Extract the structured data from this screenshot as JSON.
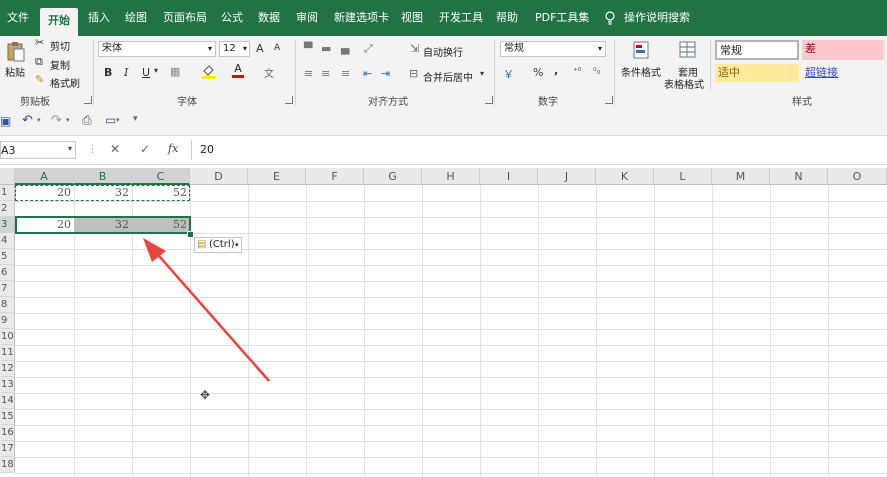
{
  "menu": {
    "items": [
      "文件",
      "开始",
      "插入",
      "绘图",
      "页面布局",
      "公式",
      "数据",
      "审阅",
      "新建选项卡",
      "视图",
      "开发工具",
      "帮助",
      "PDF工具集"
    ],
    "search": "操作说明搜索"
  },
  "clipboard": {
    "paste": "粘贴",
    "cut": "剪切",
    "copy": "复制",
    "format_painter": "格式刷",
    "label": "剪贴板"
  },
  "font": {
    "name": "宋体",
    "size": "12",
    "bold": "B",
    "italic": "I",
    "underline": "U",
    "label": "字体",
    "grow": "A",
    "shrink": "A",
    "color_letter": "A"
  },
  "alignment": {
    "wrap": "自动换行",
    "merge": "合并后居中",
    "label": "对齐方式"
  },
  "number": {
    "format": "常规",
    "percent": "%",
    "comma": ",",
    "label": "数字"
  },
  "styles": {
    "conditional": "条件格式",
    "table_format_1": "套用",
    "table_format_2": "表格格式",
    "normal": "常规",
    "bad": "差",
    "neutral": "适中",
    "hyperlink": "超链接",
    "label": "样式"
  },
  "colors": {
    "brand": "#217346",
    "bad_bg": "#ffc7ce",
    "neutral_bg": "#ffeb9c",
    "arrow": "#e8453c"
  },
  "formula_bar": {
    "name_box": "A3",
    "fx": "fx",
    "value": "20"
  },
  "sheet": {
    "columns": [
      "A",
      "B",
      "C",
      "D",
      "E",
      "F",
      "G",
      "H",
      "I",
      "J",
      "K",
      "L",
      "M",
      "N",
      "O"
    ],
    "rows": [
      "1",
      "2",
      "3",
      "4",
      "5",
      "6",
      "7",
      "8",
      "9",
      "10",
      "11",
      "12",
      "13",
      "14",
      "15",
      "16",
      "17",
      "18"
    ],
    "row1": [
      "20",
      "32",
      "52"
    ],
    "row3": [
      "20",
      "32",
      "52"
    ]
  },
  "paste_options": {
    "label": "(Ctrl)"
  }
}
